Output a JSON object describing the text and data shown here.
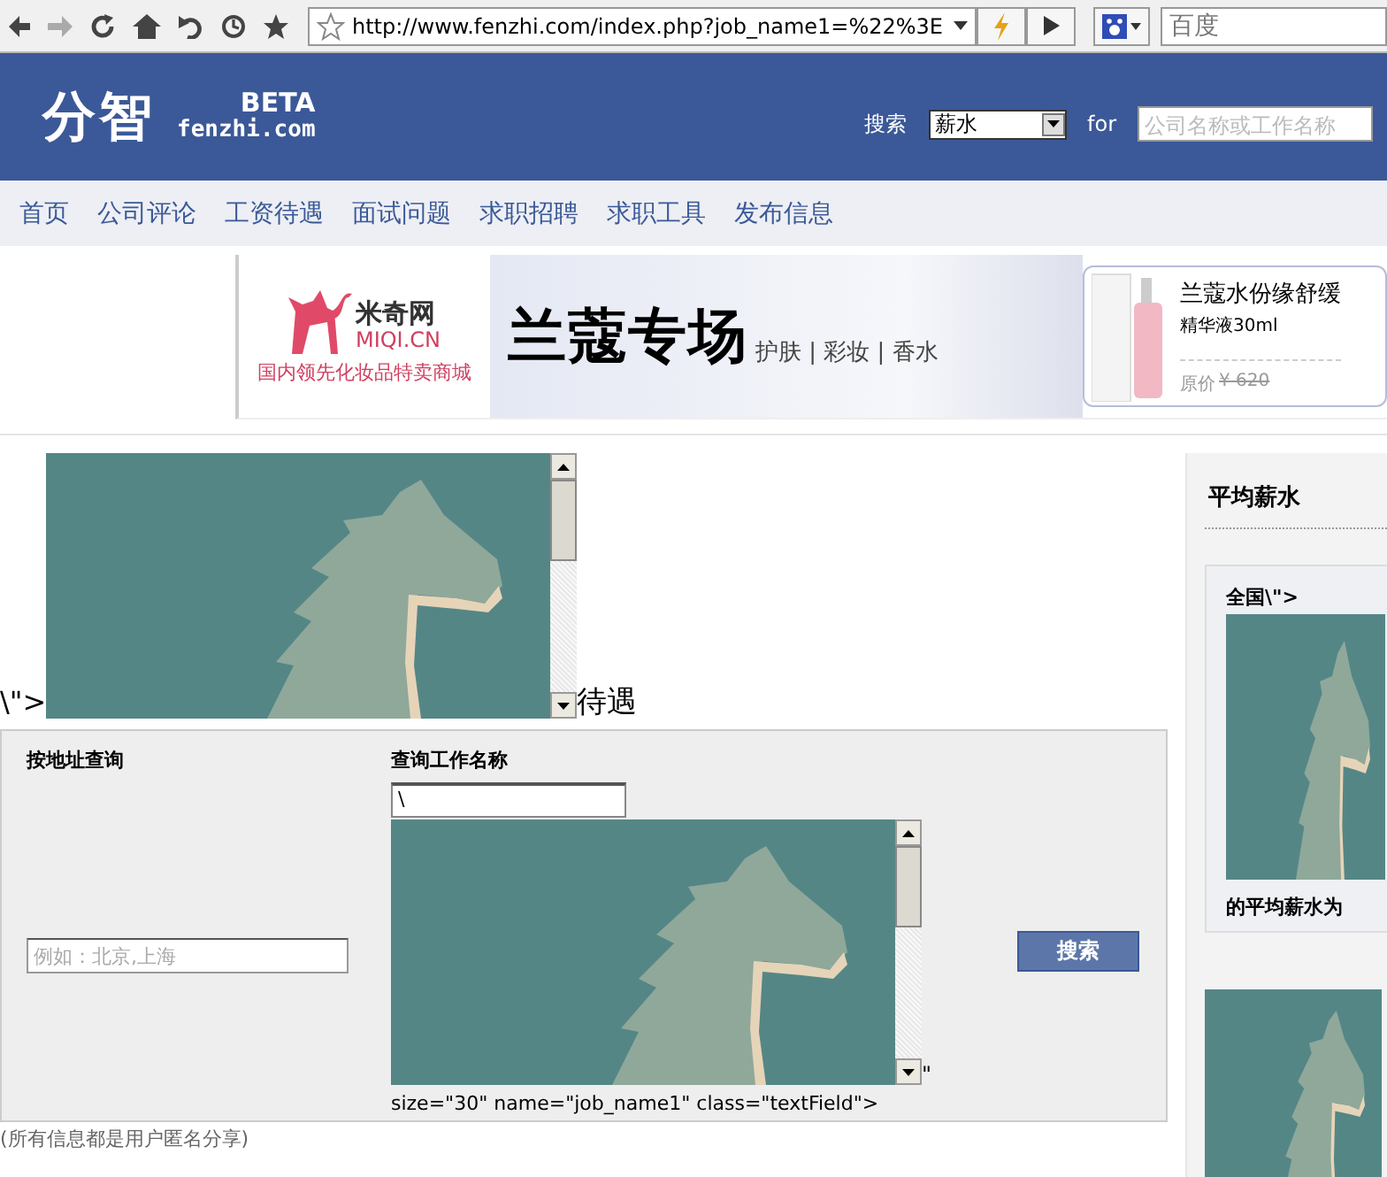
{
  "browser": {
    "url": "http://www.fenzhi.com/index.php?job_name1=%22%3E",
    "search_placeholder": "百度"
  },
  "header": {
    "logo": "分智",
    "beta": "BETA",
    "domain": "fenzhi.com",
    "search_label": "搜索",
    "search_type": "薪水",
    "for_label": "for",
    "search_placeholder": "公司名称或工作名称"
  },
  "nav": [
    "首页",
    "公司评论",
    "工资待遇",
    "面试问题",
    "求职招聘",
    "求职工具",
    "发布信息"
  ],
  "banner": {
    "brand": "米奇网",
    "brand_latin": "MIQI.CN",
    "tagline": "国内领先化妆品特卖商城",
    "headline": "兰蔻专场",
    "categories": "护肤 | 彩妆 | 香水",
    "product": "兰蔻水份缘舒缓",
    "product_detail": "精华液30ml",
    "price_label": "原价",
    "price": "¥ 620"
  },
  "injected": {
    "prefix": "\\\">",
    "suffix": "待遇"
  },
  "search_form": {
    "address_label": "按地址查询",
    "address_placeholder": "例如：北京,上海",
    "job_label": "查询工作名称",
    "job_value": "\\",
    "quote": "\"",
    "leftover": "size=\"30\" name=\"job_name1\" class=\"textField\">",
    "button": "搜索"
  },
  "footer_note": "(所有信息都是用户匿名分享)",
  "sidebar": {
    "title": "平均薪水",
    "region": "全国\\\">",
    "caption": "的平均薪水为"
  }
}
